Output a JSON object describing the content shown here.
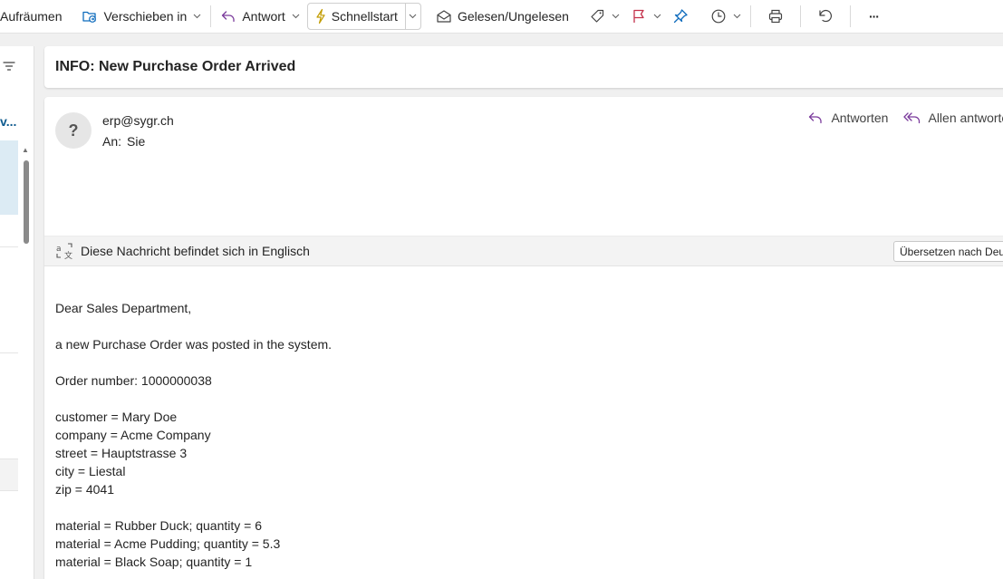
{
  "toolbar": {
    "cleanup_label": "Aufräumen",
    "move_label": "Verschieben in",
    "reply_label": "Antwort",
    "quickstep_label": "Schnellstart",
    "readunread_label": "Gelesen/Ungelesen",
    "more_label": "···",
    "icons": [
      "folder-move-icon",
      "reply-icon",
      "lightning-icon",
      "envelope-open-icon",
      "tag-icon",
      "flag-icon",
      "pin-icon",
      "clock-icon",
      "print-icon",
      "undo-icon",
      "more-icon"
    ]
  },
  "list": {
    "truncated_label": "v..."
  },
  "message": {
    "subject": "INFO: New Purchase Order Arrived",
    "avatar_text": "?",
    "sender": "erp@sygr.ch",
    "to_label": "An:",
    "to_value": "Sie",
    "reply_label": "Antworten",
    "reply_all_label": "Allen antworten",
    "translate_notice": "Diese Nachricht befindet sich in Englisch",
    "translate_button": "Übersetzen nach Deutsch",
    "body": {
      "greeting": "Dear Sales Department,",
      "intro": "a new Purchase Order was posted in the system.",
      "order_number": "Order number: 1000000038",
      "customer": "customer = Mary Doe",
      "company": "company = Acme Company",
      "street": "street = Hauptstrasse 3",
      "city": "city = Liestal",
      "zip": "zip = 4041",
      "item1": "material = Rubber Duck; quantity = 6",
      "item2": "material = Acme Pudding; quantity = 5.3",
      "item3": "material = Black Soap; quantity = 1"
    }
  },
  "colors": {
    "accent_purple": "#7b3b9c",
    "accent_blue": "#0f6cbd",
    "quickstep_yellow": "#c29c00",
    "selected_row": "#dcebf4"
  }
}
